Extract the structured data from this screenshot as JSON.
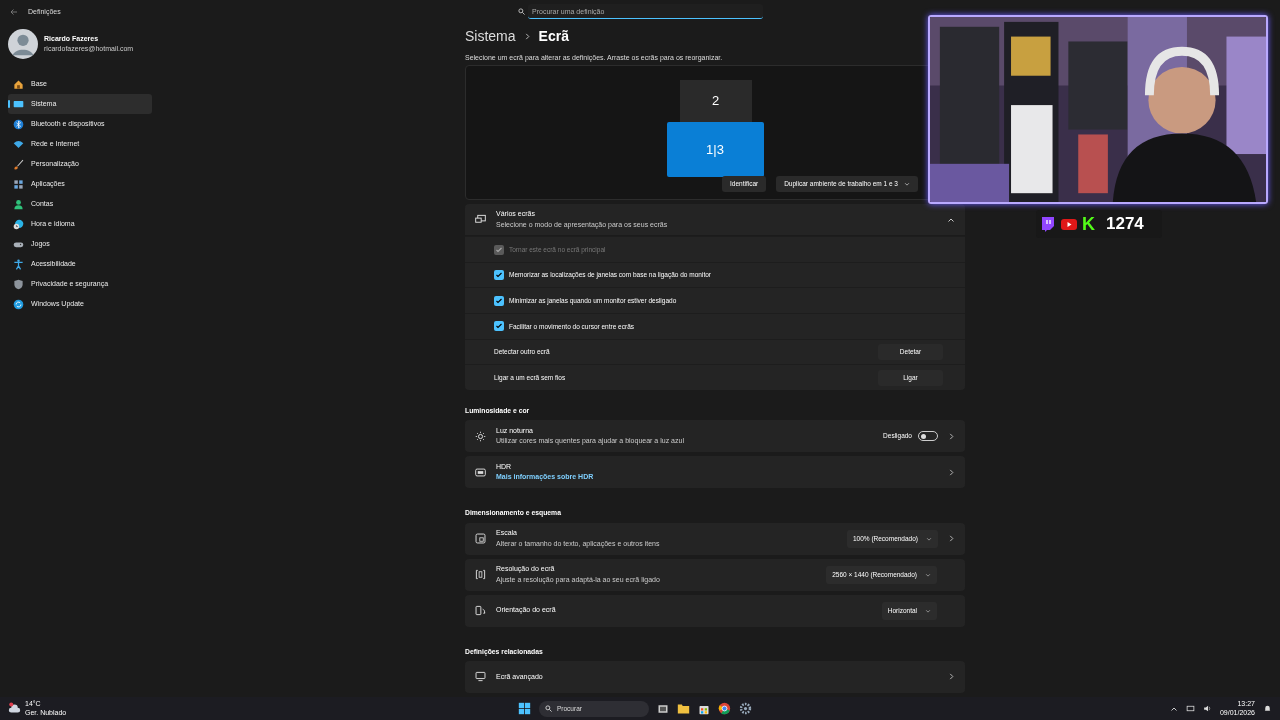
{
  "window": {
    "title": "Definições"
  },
  "search": {
    "placeholder": "Procurar uma definição"
  },
  "user": {
    "name": "Ricardo Fazeres",
    "email": "ricardofazeres@hotmail.com"
  },
  "sidebar": {
    "items": [
      {
        "label": "Base",
        "selected": false
      },
      {
        "label": "Sistema",
        "selected": true
      },
      {
        "label": "Bluetooth e dispositivos",
        "selected": false
      },
      {
        "label": "Rede e Internet",
        "selected": false
      },
      {
        "label": "Personalização",
        "selected": false
      },
      {
        "label": "Aplicações",
        "selected": false
      },
      {
        "label": "Contas",
        "selected": false
      },
      {
        "label": "Hora e idioma",
        "selected": false
      },
      {
        "label": "Jogos",
        "selected": false
      },
      {
        "label": "Acessibilidade",
        "selected": false
      },
      {
        "label": "Privacidade e segurança",
        "selected": false
      },
      {
        "label": "Windows Update",
        "selected": false
      }
    ]
  },
  "breadcrumb": [
    "Sistema",
    "Ecrã"
  ],
  "arrangement": {
    "hint": "Selecione um ecrã para alterar as definições. Arraste os ecrãs para os reorganizar.",
    "monitors": [
      {
        "label": "2",
        "selected": false
      },
      {
        "label": "1|3",
        "selected": true
      }
    ],
    "identify_button": "Identificar",
    "mode_dropdown": "Duplicar ambiente de trabalho em 1 e 3"
  },
  "multiple_displays": {
    "title": "Vários ecrãs",
    "subtitle": "Selecione o modo de apresentação para os seus ecrãs",
    "expanded": true,
    "rows": [
      {
        "kind": "checkbox",
        "label": "Tornar este ecrã no ecrã principal",
        "checked": true,
        "disabled": true
      },
      {
        "kind": "checkbox",
        "label": "Memorizar as localizações de janelas com base na ligação do monitor",
        "checked": true,
        "disabled": false
      },
      {
        "kind": "checkbox",
        "label": "Minimizar as janelas quando um monitor estiver desligado",
        "checked": true,
        "disabled": false
      },
      {
        "kind": "checkbox",
        "label": "Facilitar o movimento do cursor entre ecrãs",
        "checked": true,
        "disabled": false
      },
      {
        "kind": "button",
        "label": "Detectar outro ecrã",
        "button": "Detetar"
      },
      {
        "kind": "button",
        "label": "Ligar a um ecrã sem fios",
        "button": "Ligar"
      }
    ]
  },
  "sections": [
    {
      "heading": "Luminosidade e cor",
      "rows": [
        {
          "kind": "toggle",
          "title": "Luz noturna",
          "subtitle": "Utilizar cores mais quentes para ajudar a bloquear a luz azul",
          "state_label": "Desligado",
          "on": false,
          "chevron": true
        },
        {
          "kind": "link",
          "title": "HDR",
          "link": "Mais informações sobre HDR",
          "chevron": true
        }
      ]
    },
    {
      "heading": "Dimensionamento e esquema",
      "rows": [
        {
          "kind": "dropdown",
          "title": "Escala",
          "subtitle": "Alterar o tamanho do texto, aplicações e outros itens",
          "value": "100% (Recomendado)",
          "chevron": true
        },
        {
          "kind": "dropdown",
          "title": "Resolução do ecrã",
          "subtitle": "Ajuste a resolução para adaptá-la ao seu ecrã ligado",
          "value": "2560 × 1440 (Recomendado)",
          "chevron": false
        },
        {
          "kind": "dropdown",
          "title": "Orientação do ecrã",
          "value": "Horizontal",
          "chevron": false
        }
      ]
    },
    {
      "heading": "Definições relacionadas",
      "rows": [
        {
          "kind": "plain",
          "title": "Ecrã avançado",
          "chevron": true
        }
      ]
    }
  ],
  "stream_overlay": {
    "logo_letter": "K",
    "counter": "1274"
  },
  "taskbar": {
    "temperature": "14°C",
    "condition": "Ger. Nublado",
    "search_placeholder": "Procurar",
    "time": "13:27",
    "date": "09/01/2026"
  }
}
